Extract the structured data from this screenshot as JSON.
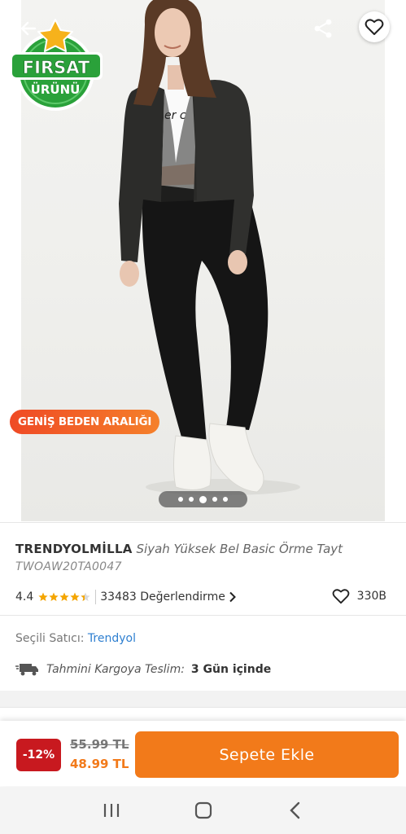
{
  "hero": {
    "badge_top": "FIRSAT",
    "badge_bottom": "ÜRÜNÜ",
    "photo_text": "er c",
    "wide_size_label": "GENİŞ BEDEN ARALIĞI",
    "image_count": 5,
    "active_image_index": 2
  },
  "product": {
    "brand": "TRENDYOLMİLLA",
    "name": "Siyah Yüksek Bel Basic Örme Tayt",
    "sku": "TWOAW20TA0047",
    "rating": "4.4",
    "rating_value": 4.4,
    "rating_max": 5,
    "reviews_label": "33483 Değerlendirme",
    "favorites_count": "330B"
  },
  "seller": {
    "label": "Seçili Satıcı:",
    "name": "Trendyol"
  },
  "shipping": {
    "label": "Tahmini Kargoya Teslim:",
    "value": "3 Gün içinde"
  },
  "purchase": {
    "discount": "-12%",
    "old_price": "55.99 TL",
    "new_price": "48.99 TL",
    "add_to_cart_label": "Sepete Ekle"
  },
  "colors": {
    "accent": "#f27a1a",
    "discount_bg": "#c8191f",
    "seller_link": "#2e7fd0",
    "star": "#f4a500"
  }
}
